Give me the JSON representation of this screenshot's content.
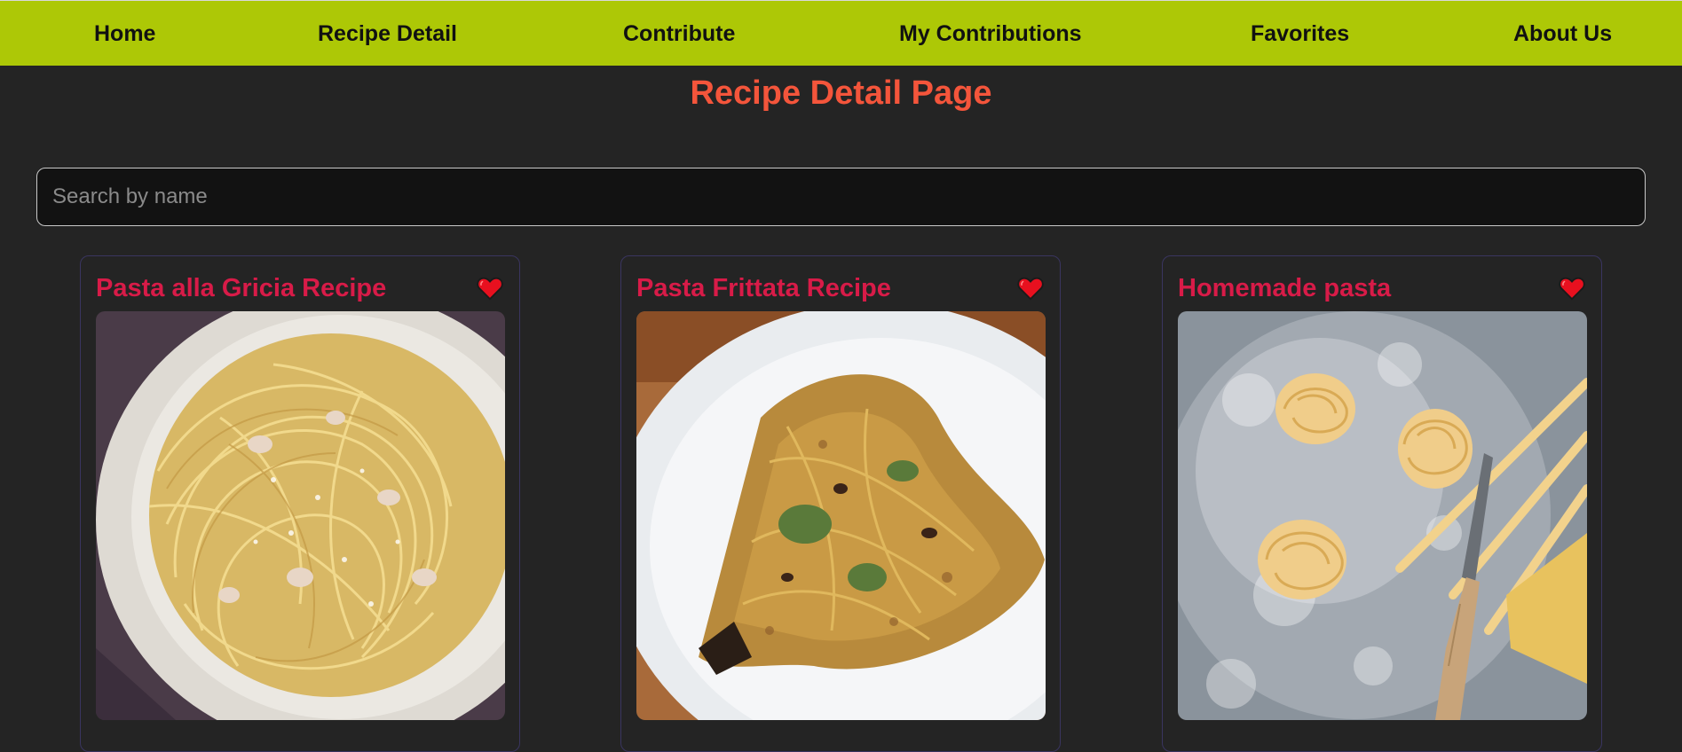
{
  "nav": {
    "items": [
      {
        "label": "Home"
      },
      {
        "label": "Recipe Detail"
      },
      {
        "label": "Contribute"
      },
      {
        "label": "My Contributions"
      },
      {
        "label": "Favorites"
      },
      {
        "label": "About Us"
      }
    ]
  },
  "page": {
    "title": "Recipe Detail Page"
  },
  "search": {
    "placeholder": "Search by name",
    "value": ""
  },
  "recipes": [
    {
      "title": "Pasta alla Gricia Recipe",
      "favorite": true,
      "image": "spaghetti-with-pancetta-and-cheese"
    },
    {
      "title": "Pasta Frittata Recipe",
      "favorite": true,
      "image": "pasta-frittata-slice-on-plate"
    },
    {
      "title": "Homemade pasta",
      "favorite": true,
      "image": "fresh-tagliatelle-nests-with-flour-and-knife"
    }
  ],
  "colors": {
    "navbar": "#adc806",
    "background": "#242424",
    "page_title": "#f4553b",
    "card_title": "#d81b48",
    "heart": "#e8101f"
  }
}
